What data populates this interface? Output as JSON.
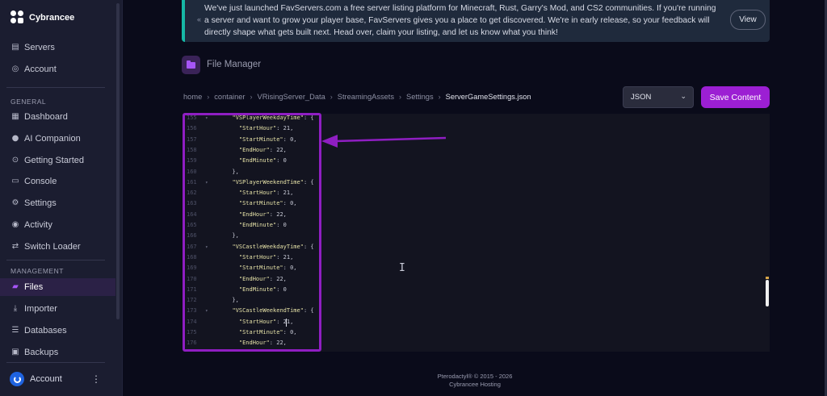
{
  "brand": {
    "name": "Cybrancee"
  },
  "sidebar": {
    "top_items": [
      {
        "label": "Servers",
        "icon": "server-icon"
      },
      {
        "label": "Account",
        "icon": "account-icon"
      }
    ],
    "general_title": "GENERAL",
    "general_items": [
      {
        "label": "Dashboard",
        "icon": "dashboard-icon"
      },
      {
        "label": "AI Companion",
        "icon": "chat-icon"
      },
      {
        "label": "Getting Started",
        "icon": "help-icon"
      },
      {
        "label": "Console",
        "icon": "terminal-icon"
      },
      {
        "label": "Settings",
        "icon": "gear-icon"
      },
      {
        "label": "Activity",
        "icon": "eye-icon"
      },
      {
        "label": "Switch Loader",
        "icon": "swap-icon"
      }
    ],
    "management_title": "MANAGEMENT",
    "management_items": [
      {
        "label": "Files",
        "icon": "folder-icon",
        "active": true
      },
      {
        "label": "Importer",
        "icon": "download-icon"
      },
      {
        "label": "Databases",
        "icon": "database-icon"
      },
      {
        "label": "Backups",
        "icon": "archive-icon"
      }
    ],
    "footer": {
      "account_label": "Account"
    }
  },
  "banner": {
    "text": "We've just launched FavServers.com a free server listing platform for Minecraft, Rust, Garry's Mod, and CS2 communities. If you're running a server and want to grow your player base, FavServers gives you a place to get discovered. We're in early release, so your feedback will directly shape what gets built next. Head over, claim your listing, and let us know what you think!",
    "bullet": "«",
    "view_label": "View"
  },
  "file_manager": {
    "title": "File Manager",
    "breadcrumb": [
      "home",
      "container",
      "VRisingServer_Data",
      "StreamingAssets",
      "Settings"
    ],
    "current_file": "ServerGameSettings.json",
    "language_select": "JSON",
    "save_label": "Save Content"
  },
  "editor": {
    "lines": [
      {
        "num": "155",
        "fold": "▾",
        "text": "  \"VSPlayerWeekdayTime\": {"
      },
      {
        "num": "156",
        "fold": "",
        "text": "    \"StartHour\": 21,"
      },
      {
        "num": "157",
        "fold": "",
        "text": "    \"StartMinute\": 0,"
      },
      {
        "num": "158",
        "fold": "",
        "text": "    \"EndHour\": 22,"
      },
      {
        "num": "159",
        "fold": "",
        "text": "    \"EndMinute\": 0"
      },
      {
        "num": "160",
        "fold": "",
        "text": "  },"
      },
      {
        "num": "161",
        "fold": "▾",
        "text": "  \"VSPlayerWeekendTime\": {"
      },
      {
        "num": "162",
        "fold": "",
        "text": "    \"StartHour\": 21,"
      },
      {
        "num": "163",
        "fold": "",
        "text": "    \"StartMinute\": 0,"
      },
      {
        "num": "164",
        "fold": "",
        "text": "    \"EndHour\": 22,"
      },
      {
        "num": "165",
        "fold": "",
        "text": "    \"EndMinute\": 0"
      },
      {
        "num": "166",
        "fold": "",
        "text": "  },"
      },
      {
        "num": "167",
        "fold": "▾",
        "text": "  \"VSCastleWeekdayTime\": {"
      },
      {
        "num": "168",
        "fold": "",
        "text": "    \"StartHour\": 21,"
      },
      {
        "num": "169",
        "fold": "",
        "text": "    \"StartMinute\": 0,"
      },
      {
        "num": "170",
        "fold": "",
        "text": "    \"EndHour\": 22,"
      },
      {
        "num": "171",
        "fold": "",
        "text": "    \"EndMinute\": 0"
      },
      {
        "num": "172",
        "fold": "",
        "text": "  },"
      },
      {
        "num": "173",
        "fold": "▾",
        "text": "  \"VSCastleWeekendTime\": {"
      },
      {
        "num": "174",
        "fold": "",
        "text": "    \"StartHour\": 21,"
      },
      {
        "num": "175",
        "fold": "",
        "text": "    \"StartMinute\": 0,"
      },
      {
        "num": "176",
        "fold": "",
        "text": "    \"EndHour\": 22,"
      }
    ]
  },
  "footer": {
    "copyright": "Pterodactyl® © 2015 - 2026",
    "host": "Cybrancee Hosting"
  },
  "colors": {
    "accent": "#9c1fd3",
    "annotation": "#8f1ec2",
    "banner_stripe": "#16b8a6"
  }
}
